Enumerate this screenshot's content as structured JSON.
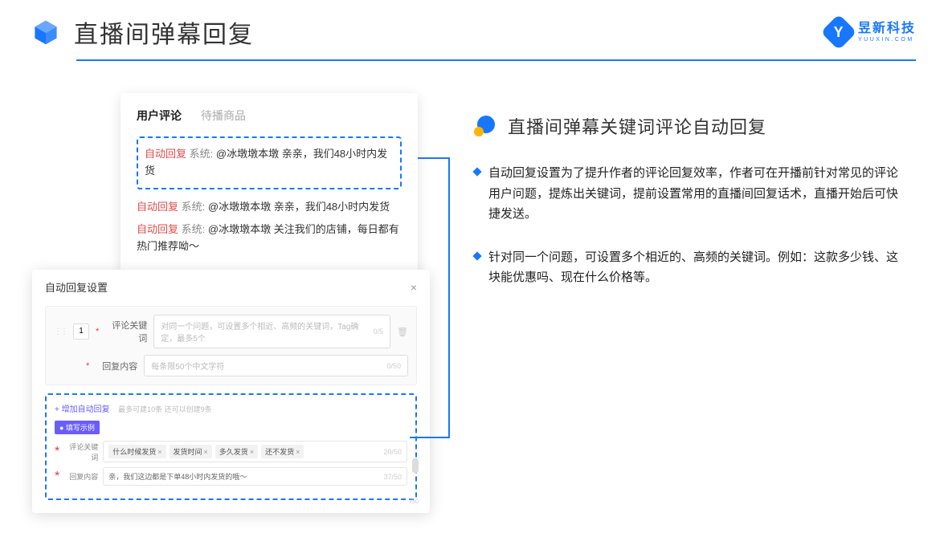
{
  "header": {
    "title": "直播间弹幕回复",
    "brand_cn": "昱新科技",
    "brand_en": "YUUXIN.COM"
  },
  "panelA": {
    "tab_active": "用户评论",
    "tab_inactive": "待播商品",
    "highlight_tag": "自动回复",
    "highlight_sys": "系统:",
    "highlight_text": "@冰墩墩本墩 亲亲，我们48小时内发货",
    "c2_tag": "自动回复",
    "c2_sys": "系统:",
    "c2_text": "@冰墩墩本墩 亲亲，我们48小时内发货",
    "c3_tag": "自动回复",
    "c3_sys": "系统:",
    "c3_text": "@冰墩墩本墩 关注我们的店铺，每日都有热门推荐呦～"
  },
  "panelB": {
    "title": "自动回复设置",
    "order": "1",
    "label_keyword": "评论关键词",
    "placeholder_keyword": "对同一个问题，可设置多个相近、高频的关键词，Tag确定，最多5个",
    "counter_keyword": "0/5",
    "label_content": "回复内容",
    "placeholder_content": "每条限50个中文字符",
    "counter_content": "0/50",
    "add_link": "+ 增加自动回复",
    "add_hint": "最多可建10条 还可以创建9条",
    "example_badge": "● 填写示例",
    "ex_label_kw": "评论关键词",
    "ex_tags": [
      "什么时候发货",
      "发货时间",
      "多久发货",
      "还不发货"
    ],
    "ex_kw_counter": "20/50",
    "ex_label_content": "回复内容",
    "ex_content_val": "亲，我们这边都是下单48小时内发货的哦～",
    "ex_content_counter": "37/50",
    "outer_counter": "/50"
  },
  "right": {
    "title": "直播间弹幕关键词评论自动回复",
    "bullet1": "自动回复设置为了提升作者的评论回复效率，作者可在开播前针对常见的评论用户问题，提炼出关键词，提前设置常用的直播间回复话术，直播开始后可快捷发送。",
    "bullet2": "针对同一个问题，可设置多个相近的、高频的关键词。例如：这款多少钱、这块能优惠吗、现在什么价格等。"
  }
}
